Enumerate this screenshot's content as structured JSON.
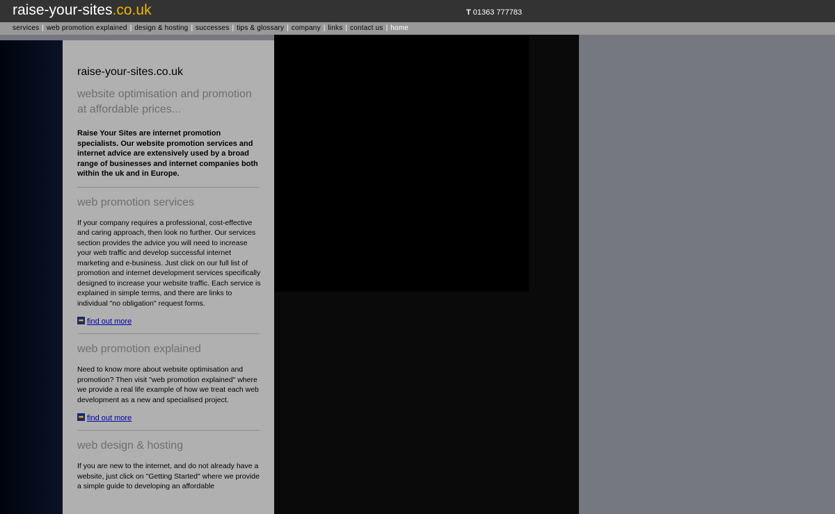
{
  "header": {
    "logo_main": "raise-your-sites",
    "logo_tld": ".co.uk",
    "phone_prefix": "T",
    "phone_number": "01363 777783"
  },
  "nav": [
    {
      "label": "services"
    },
    {
      "label": "web promotion explained"
    },
    {
      "label": "design & hosting"
    },
    {
      "label": "successes"
    },
    {
      "label": "tips & glossary"
    },
    {
      "label": "company"
    },
    {
      "label": "links"
    },
    {
      "label": "contact us"
    },
    {
      "label": "home",
      "active": true
    }
  ],
  "content": {
    "site_title": "raise-your-sites.co.uk",
    "tagline": "website optimisation and promotion at affordable prices...",
    "intro": "Raise Your Sites are internet promotion specialists. Our website promotion services and internet advice are extensively used by a broad range of businesses and internet companies both within the uk and in Europe.",
    "sections": [
      {
        "title": "web promotion services",
        "body": "If your company requires a professional, cost-effective and caring approach, then look no further. Our services section provides the advice you will need to increase your web traffic and develop successful internet marketing and e-business. Just click on our full list of promotion and internet development services specifically designed to increase your website traffic. Each service is explained in simple terms, and there are links to individual \"no obligation\" request forms.",
        "link": "find out more"
      },
      {
        "title": "web promotion explained",
        "body": "Need to know more about website optimisation and promotion? Then visit \"web promotion explained\" where we provide a real life example of how we treat each web development as a new and specialised project.",
        "link": "find out more"
      },
      {
        "title": "web design & hosting",
        "body": "If you are new to the internet, and do not already have a website, just click on \"Getting Started\" where we provide a simple guide to developing an affordable"
      }
    ]
  },
  "colors": {
    "header_bg": "#333333",
    "nav_bg": "#999999",
    "logo_accent": "#f0b400",
    "content_bg": "#b0b0b0",
    "page_bg": "#767880"
  },
  "icons": {
    "link_arrow": "arrow-right-icon"
  }
}
